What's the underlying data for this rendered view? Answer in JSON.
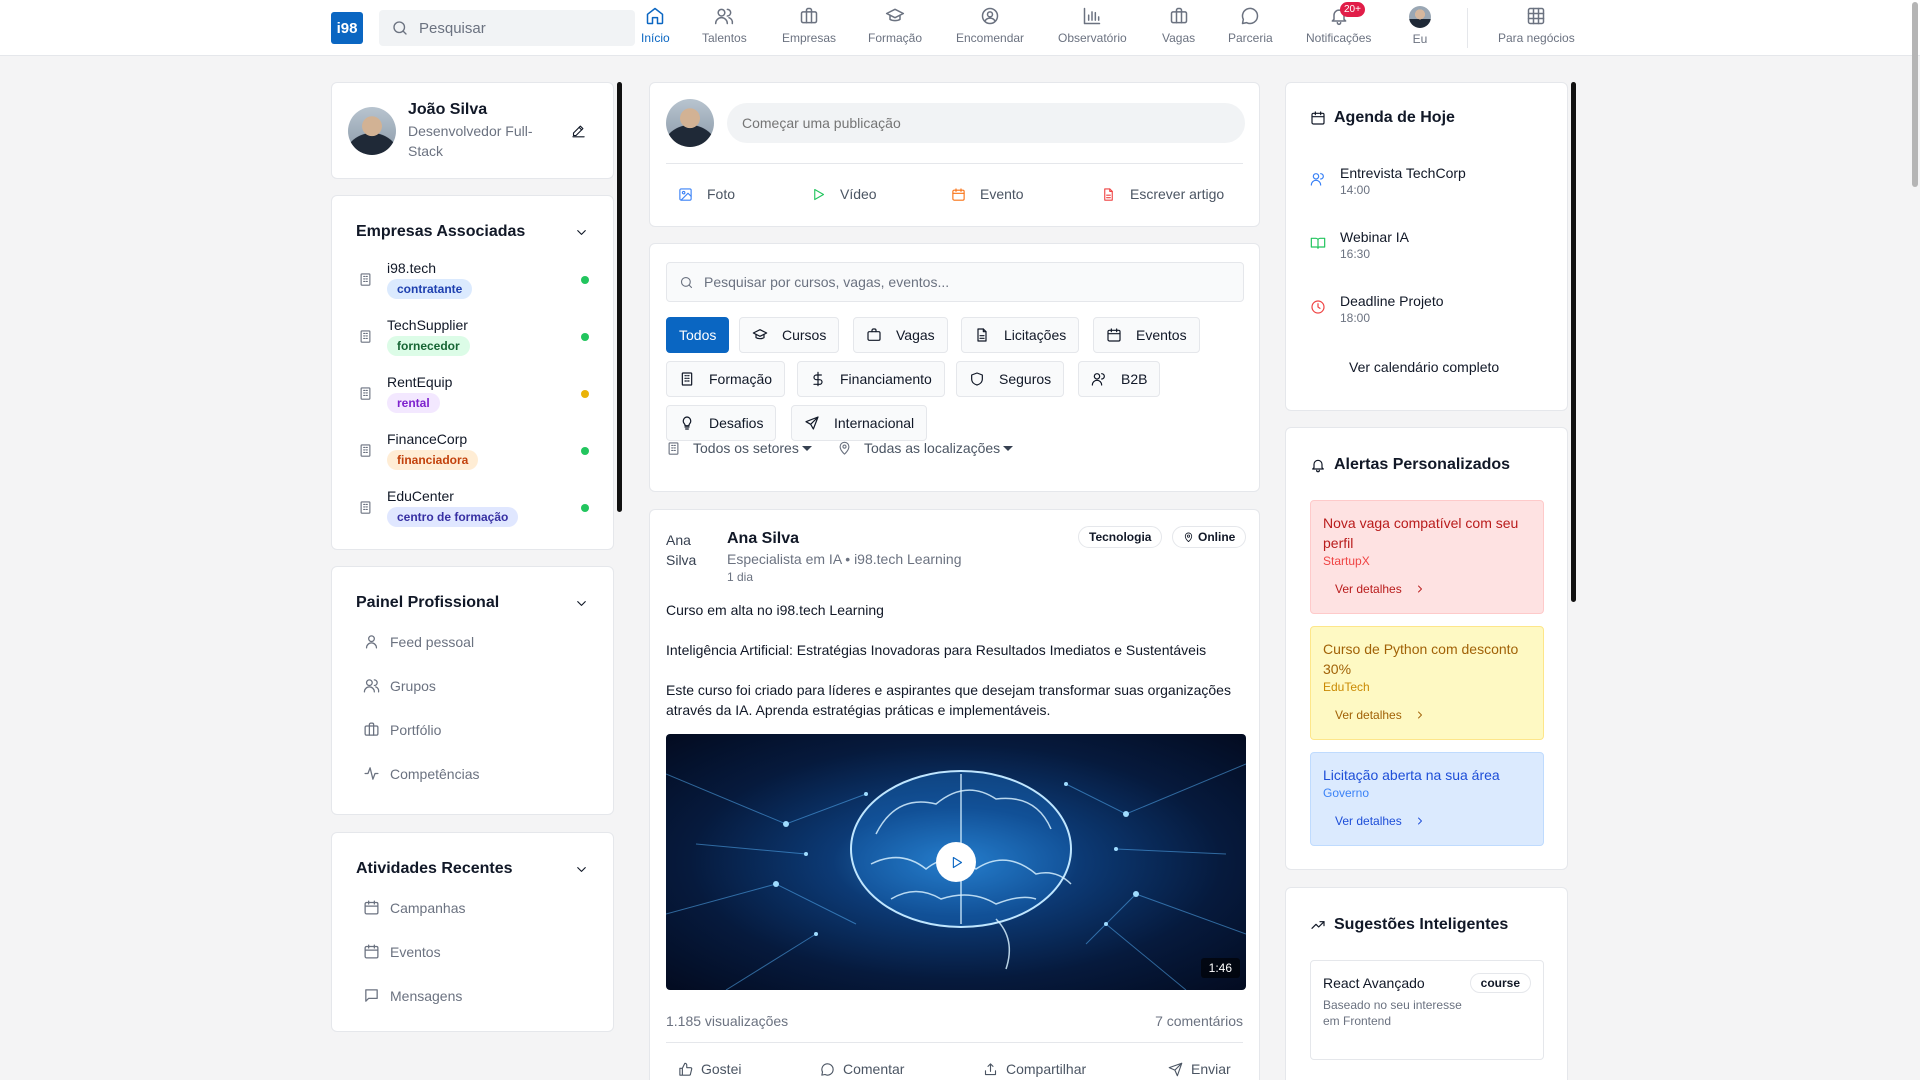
{
  "nav": {
    "logo": "i98",
    "search_placeholder": "Pesquisar",
    "items": [
      {
        "label": "Início",
        "icon": "home-icon"
      },
      {
        "label": "Talentos",
        "icon": "users-icon"
      },
      {
        "label": "Empresas",
        "icon": "briefcase-icon"
      },
      {
        "label": "Formação",
        "icon": "graduation-cap-icon"
      },
      {
        "label": "Encomendar",
        "icon": "user-circle-icon"
      },
      {
        "label": "Observatório",
        "icon": "bar-chart-icon"
      },
      {
        "label": "Vagas",
        "icon": "briefcase-icon"
      },
      {
        "label": "Parceria",
        "icon": "message-circle-icon"
      },
      {
        "label": "Notificações",
        "icon": "bell-icon",
        "badge": "20+"
      },
      {
        "label": "Eu",
        "icon": "avatar"
      },
      {
        "label": "Para negócios",
        "icon": "grid-icon"
      }
    ]
  },
  "profile": {
    "name": "João Silva",
    "role": "Desenvolvedor Full-Stack"
  },
  "companies": {
    "title": "Empresas Associadas",
    "items": [
      {
        "name": "i98.tech",
        "tag": "contratante",
        "tag_bg": "#dbeafe",
        "tag_fg": "#1e40af",
        "status": "#22c55e"
      },
      {
        "name": "TechSupplier",
        "tag": "fornecedor",
        "tag_bg": "#dcfce7",
        "tag_fg": "#166534",
        "status": "#22c55e"
      },
      {
        "name": "RentEquip",
        "tag": "rental",
        "tag_bg": "#f3e8ff",
        "tag_fg": "#7e22ce",
        "status": "#eab308"
      },
      {
        "name": "FinanceCorp",
        "tag": "financiadora",
        "tag_bg": "#ffedd5",
        "tag_fg": "#c2410c",
        "status": "#22c55e"
      },
      {
        "name": "EduCenter",
        "tag": "centro de formação",
        "tag_bg": "#e0e7ff",
        "tag_fg": "#3730a3",
        "status": "#22c55e"
      }
    ]
  },
  "panel": {
    "title": "Painel Profissional",
    "items": [
      "Feed pessoal",
      "Grupos",
      "Portfólio",
      "Competências"
    ]
  },
  "activities": {
    "title": "Atividades Recentes",
    "items": [
      "Campanhas",
      "Eventos",
      "Mensagens"
    ]
  },
  "composer": {
    "placeholder": "Começar uma publicação",
    "actions": [
      "Foto",
      "Vídeo",
      "Evento",
      "Escrever artigo"
    ]
  },
  "filters": {
    "search_placeholder": "Pesquisar por cursos, vagas, eventos...",
    "chips": [
      "Todos",
      "Cursos",
      "Vagas",
      "Licitações",
      "Eventos",
      "Formação",
      "Financiamento",
      "Seguros",
      "B2B",
      "Desafios",
      "Internacional"
    ],
    "sector": "Todos os setores",
    "location": "Todas as localizações"
  },
  "post": {
    "author": "Ana Silva",
    "avatar_alt": "Ana Silva",
    "subtitle": "Especialista em IA • i98.tech Learning",
    "time": "1 dia",
    "category": "Tecnologia",
    "mode": "Online",
    "line1": "Curso em alta no i98.tech Learning",
    "line2": "Inteligência Artificial: Estratégias Inovadoras para Resultados Imediatos e Sustentáveis",
    "line3": "Este curso foi criado para líderes e aspirantes que desejam transformar suas organizações através da IA. Aprenda estratégias práticas e implementáveis.",
    "duration": "1:46",
    "views": "1.185 visualizações",
    "comments": "7 comentários",
    "actions": [
      "Gostei",
      "Comentar",
      "Compartilhar",
      "Enviar"
    ]
  },
  "agenda": {
    "title": "Agenda de Hoje",
    "items": [
      {
        "title": "Entrevista TechCorp",
        "time": "14:00",
        "color": "#3b82f6"
      },
      {
        "title": "Webinar IA",
        "time": "16:30",
        "color": "#22c55e"
      },
      {
        "title": "Deadline Projeto",
        "time": "18:00",
        "color": "#ef4444"
      }
    ],
    "link": "Ver calendário completo"
  },
  "alerts": {
    "title": "Alertas Personalizados",
    "items": [
      {
        "title": "Nova vaga compatível com seu perfil",
        "source": "StartupX",
        "link": "Ver detalhes"
      },
      {
        "title": "Curso de Python com desconto 30%",
        "source": "EduTech",
        "link": "Ver detalhes"
      },
      {
        "title": "Licitação aberta na sua área",
        "source": "Governo",
        "link": "Ver detalhes"
      }
    ]
  },
  "suggestions": {
    "title": "Sugestões Inteligentes",
    "items": [
      {
        "title": "React Avançado",
        "type": "course",
        "reason": "Baseado no seu interesse em Frontend"
      }
    ]
  }
}
